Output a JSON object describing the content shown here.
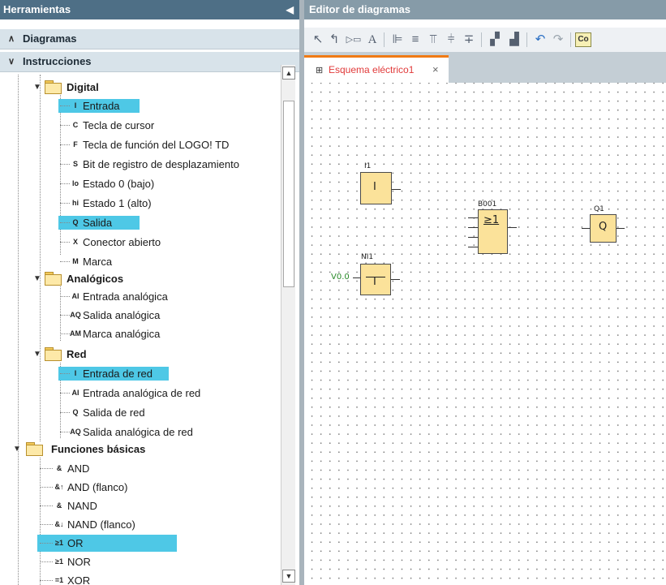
{
  "left_panel": {
    "title": "Herramientas",
    "collapse_arrow": "◀",
    "sections": [
      {
        "label": "Diagramas",
        "chevron": "∧"
      },
      {
        "label": "Instrucciones",
        "chevron": "∨"
      }
    ]
  },
  "tree": {
    "digital": {
      "label": "Digital",
      "items": [
        {
          "icon": "I",
          "label": "Entrada",
          "highlighted": true
        },
        {
          "icon": "C",
          "label": "Tecla de cursor"
        },
        {
          "icon": "F",
          "label": "Tecla de función del LOGO! TD"
        },
        {
          "icon": "S",
          "label": "Bit de registro de desplazamiento"
        },
        {
          "icon": "lo",
          "label": "Estado 0 (bajo)"
        },
        {
          "icon": "hi",
          "label": "Estado 1 (alto)"
        },
        {
          "icon": "Q",
          "label": "Salida",
          "highlighted": true
        },
        {
          "icon": "X",
          "label": "Conector abierto"
        },
        {
          "icon": "M",
          "label": "Marca"
        }
      ]
    },
    "analogicos": {
      "label": "Analógicos",
      "items": [
        {
          "icon": "AI",
          "label": "Entrada analógica"
        },
        {
          "icon": "AQ",
          "label": "Salida analógica"
        },
        {
          "icon": "AM",
          "label": "Marca analógica"
        }
      ]
    },
    "red": {
      "label": "Red",
      "items": [
        {
          "icon": "I",
          "label": "Entrada de red",
          "highlighted": true
        },
        {
          "icon": "AI",
          "label": "Entrada analógica de red"
        },
        {
          "icon": "Q",
          "label": "Salida de red"
        },
        {
          "icon": "AQ",
          "label": "Salida analógica de red"
        }
      ]
    },
    "basicas": {
      "label": "Funciones básicas",
      "items": [
        {
          "icon": "&",
          "label": "AND"
        },
        {
          "icon": "&↑",
          "label": "AND (flanco)"
        },
        {
          "icon": "&",
          "label": "NAND"
        },
        {
          "icon": "&↓",
          "label": "NAND (flanco)"
        },
        {
          "icon": "≥1",
          "label": "OR",
          "highlighted": true
        },
        {
          "icon": "≥1",
          "label": "NOR"
        },
        {
          "icon": "=1",
          "label": "XOR"
        }
      ]
    }
  },
  "right_panel": {
    "title": "Editor de diagramas",
    "toolbar_last": "Co",
    "tab_label": "Esquema eléctrico1",
    "tab_close": "×"
  },
  "diagram": {
    "blocks": [
      {
        "name": "I1",
        "symbol": "I"
      },
      {
        "name": "B001",
        "symbol": "≥1"
      },
      {
        "name": "Q1",
        "symbol": "Q"
      },
      {
        "name": "NI1",
        "symbol": "I",
        "input_value": "V0.0"
      }
    ]
  },
  "colors": {
    "title_bar": "#4e6f86",
    "highlight": "#4ec8e6",
    "block_fill": "#fbe29a",
    "tab_accent": "#f07a14",
    "tab_text": "#e13a3a"
  }
}
